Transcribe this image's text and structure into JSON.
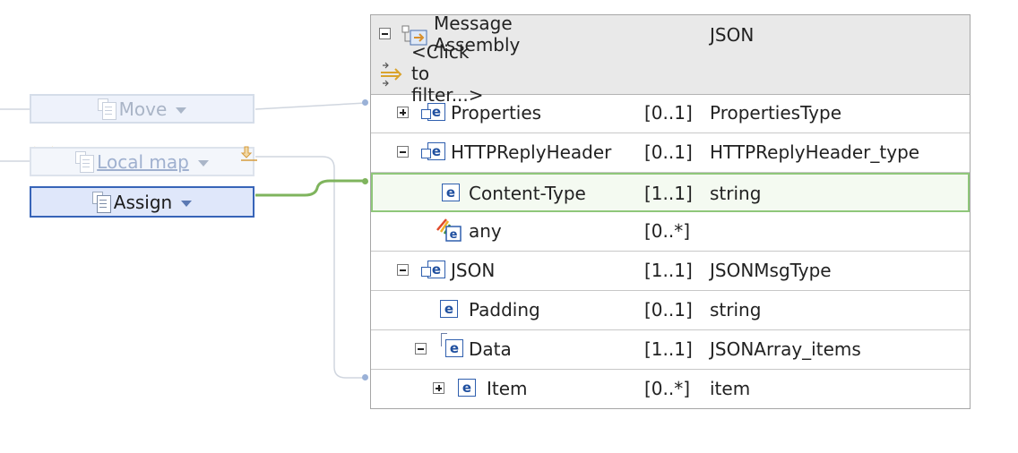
{
  "transforms": {
    "move": {
      "label": "Move"
    },
    "local_map": {
      "label": "Local map"
    },
    "assign": {
      "label": "Assign"
    }
  },
  "tree": {
    "root": {
      "name": "Message Assembly",
      "type": "JSON"
    },
    "filter_text": "<Click to filter...>",
    "rows": [
      {
        "name": "Properties",
        "card": "[0..1]",
        "type": "PropertiesType"
      },
      {
        "name": "HTTPReplyHeader",
        "card": "[0..1]",
        "type": "HTTPReplyHeader_type"
      },
      {
        "name": "Content-Type",
        "card": "[1..1]",
        "type": "string"
      },
      {
        "name": "any",
        "card": "[0..*]",
        "type": ""
      },
      {
        "name": "JSON",
        "card": "[1..1]",
        "type": "JSONMsgType"
      },
      {
        "name": "Padding",
        "card": "[0..1]",
        "type": "string"
      },
      {
        "name": "Data",
        "card": "[1..1]",
        "type": "JSONArray_items"
      },
      {
        "name": "Item",
        "card": "[0..*]",
        "type": "item"
      }
    ]
  },
  "colors": {
    "selected_connection": "#7fb45d",
    "selection_border": "#8fc77a",
    "assign_border": "#3764b8"
  },
  "icons": [
    "collapse-icon",
    "expand-icon",
    "message-assembly-icon",
    "filter-icon",
    "element-icon",
    "element-reference-icon",
    "any-element-icon",
    "warning-icon",
    "lightbulb-icon",
    "transfer-icon",
    "transform-document-icon",
    "dropdown-arrow-icon"
  ]
}
